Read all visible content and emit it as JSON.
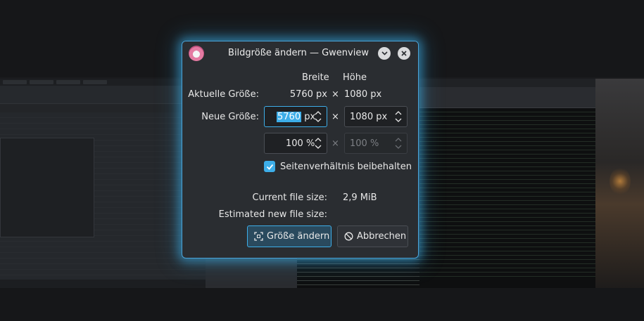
{
  "dialog": {
    "title": "Bildgröße ändern — Gwenview",
    "header": {
      "width_label": "Breite",
      "height_label": "Höhe"
    },
    "current": {
      "label": "Aktuelle Größe:",
      "width": "5760 px",
      "times": "×",
      "height": "1080 px"
    },
    "new_size": {
      "label": "Neue Größe:",
      "width_number": "5760",
      "width_unit": "px",
      "times": "×",
      "height_value": "1080 px"
    },
    "percent": {
      "width_value": "100 %",
      "times": "×",
      "height_value": "100 %"
    },
    "keep_ratio": {
      "label": "Seitenverhältnis beibehalten",
      "checked": true
    },
    "current_file_size": {
      "label": "Current file size:",
      "value": "2,9 MiB"
    },
    "estimated_size": {
      "label": "Estimated new file size:",
      "value": ""
    },
    "buttons": {
      "resize_label": "Größe ändern",
      "cancel_label": "Abbrechen"
    }
  },
  "icons": {
    "app": "gwenview-icon",
    "minimize": "chevron-down-icon",
    "close": "close-icon",
    "resize": "resize-icon",
    "cancel": "cancel-icon",
    "check": "checkmark-icon"
  },
  "colors": {
    "accent": "#3daee9",
    "dialog_bg": "#2a2d31",
    "text": "#e8e8e8",
    "disabled_text": "#7c7f84"
  }
}
